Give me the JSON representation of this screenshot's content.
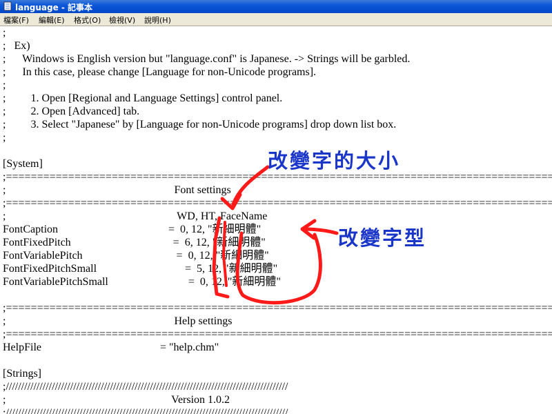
{
  "window": {
    "title": "language - 記事本"
  },
  "menu": [
    "檔案(F)",
    "編輯(E)",
    "格式(O)",
    "檢視(V)",
    "說明(H)"
  ],
  "lines": [
    ";",
    ";   Ex)",
    ";      Windows is English version but \"language.conf\" is Japanese. -> Strings will be garbled.",
    ";      In this case, please change [Language for non-Unicode programs].",
    ";",
    ";         1. Open [Regional and Language Settings] control panel.",
    ";         2. Open [Advanced] tab.",
    ";         3. Select \"Japanese\" by [Language for non-Unicode programs] drop down list box.",
    ";",
    "",
    "[System]",
    ";==============================================================================================",
    ";                                                             Font settings",
    ";==============================================================================================",
    ";                                                              WD, HT, FaceName",
    "FontCaption                                        =  0, 12, \"新細明體\"",
    "FontFixedPitch                                     =  6, 12, \"新細明體\"",
    "FontVariablePitch                                  =  0, 12, \"新細明體\"",
    "FontFixedPitchSmall                                =  5, 12, \"新細明體\"",
    "FontVariablePitchSmall                             =  0, 12, \"新細明體\"",
    "",
    ";==============================================================================================",
    ";                                                             Help settings",
    ";==============================================================================================",
    "HelpFile                                           = \"help.chm\"",
    "",
    "[Strings]",
    ";////////////////////////////////////////////////////////////////////////////////////////////",
    ";                                                            Version 1.0.2",
    ";////////////////////////////////////////////////////////////////////////////////////////////"
  ],
  "annotations": {
    "size_label": "改變字的大小",
    "font_label": "改變字型",
    "color": "#1a36c8",
    "markup_color": "#ff1a1a"
  }
}
